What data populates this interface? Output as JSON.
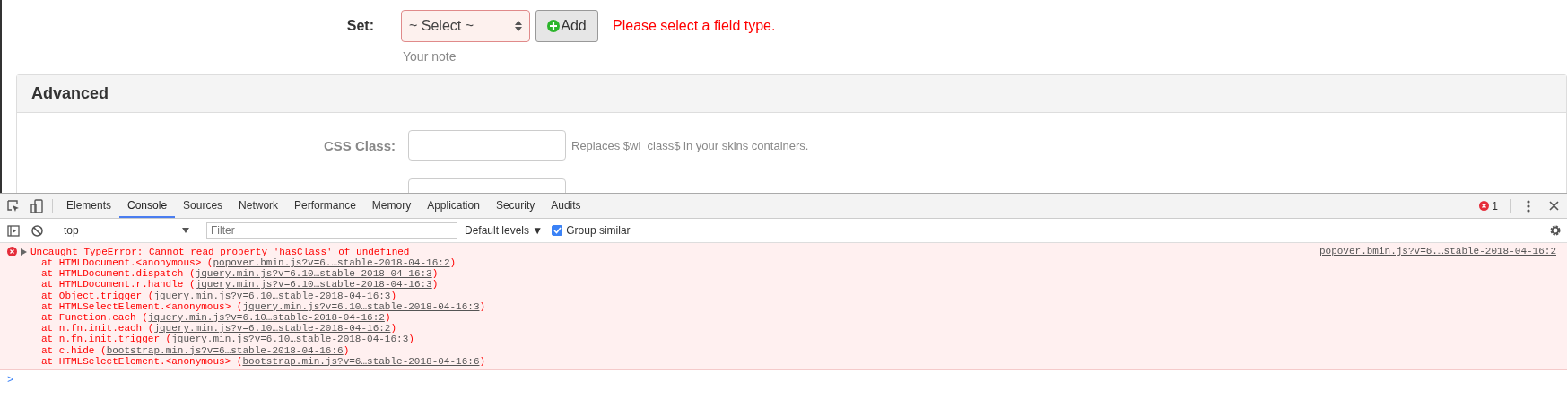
{
  "form": {
    "set_label": "Set:",
    "select": {
      "value": "~ Select ~",
      "invalid": true
    },
    "add_button": "Add",
    "error": "Please select a field type.",
    "note": "Your note"
  },
  "advanced": {
    "title": "Advanced",
    "fields": [
      {
        "label": "CSS Class:",
        "help": "Replaces $wi_class$ in your skins containers.",
        "kind": "text"
      },
      {
        "kind": "text"
      }
    ]
  },
  "devtools": {
    "tabs": [
      {
        "label": "Elements",
        "selected": false
      },
      {
        "label": "Console",
        "selected": true
      },
      {
        "label": "Sources",
        "selected": false
      },
      {
        "label": "Network",
        "selected": false
      },
      {
        "label": "Performance",
        "selected": false
      },
      {
        "label": "Memory",
        "selected": false
      },
      {
        "label": "Application",
        "selected": false
      },
      {
        "label": "Security",
        "selected": false
      },
      {
        "label": "Audits",
        "selected": false
      }
    ],
    "error_count": "1",
    "context": "top",
    "filter_placeholder": "Filter",
    "levels": "Default levels ▼",
    "group_similar": {
      "label": "Group similar",
      "checked": true
    },
    "message": {
      "text": "Uncaught TypeError: Cannot read property 'hasClass' of undefined",
      "source": "popover.bmin.js?v=6.…stable-2018-04-16:2",
      "frames": [
        {
          "prefix": "at HTMLDocument.<anonymous> (",
          "link": "popover.bmin.js?v=6.…stable-2018-04-16:2",
          "suffix": ")"
        },
        {
          "prefix": "at HTMLDocument.dispatch (",
          "link": "jquery.min.js?v=6.10…stable-2018-04-16:3",
          "suffix": ")"
        },
        {
          "prefix": "at HTMLDocument.r.handle (",
          "link": "jquery.min.js?v=6.10…stable-2018-04-16:3",
          "suffix": ")"
        },
        {
          "prefix": "at Object.trigger (",
          "link": "jquery.min.js?v=6.10…stable-2018-04-16:3",
          "suffix": ")"
        },
        {
          "prefix": "at HTMLSelectElement.<anonymous> (",
          "link": "jquery.min.js?v=6.10…stable-2018-04-16:3",
          "suffix": ")"
        },
        {
          "prefix": "at Function.each (",
          "link": "jquery.min.js?v=6.10…stable-2018-04-16:2",
          "suffix": ")"
        },
        {
          "prefix": "at n.fn.init.each (",
          "link": "jquery.min.js?v=6.10…stable-2018-04-16:2",
          "suffix": ")"
        },
        {
          "prefix": "at n.fn.init.trigger (",
          "link": "jquery.min.js?v=6.10…stable-2018-04-16:3",
          "suffix": ")"
        },
        {
          "prefix": "at c.hide (",
          "link": "bootstrap.min.js?v=6…stable-2018-04-16:6",
          "suffix": ")"
        },
        {
          "prefix": "at HTMLSelectElement.<anonymous> (",
          "link": "bootstrap.min.js?v=6…stable-2018-04-16:6",
          "suffix": ")"
        }
      ]
    },
    "prompt": ">"
  }
}
